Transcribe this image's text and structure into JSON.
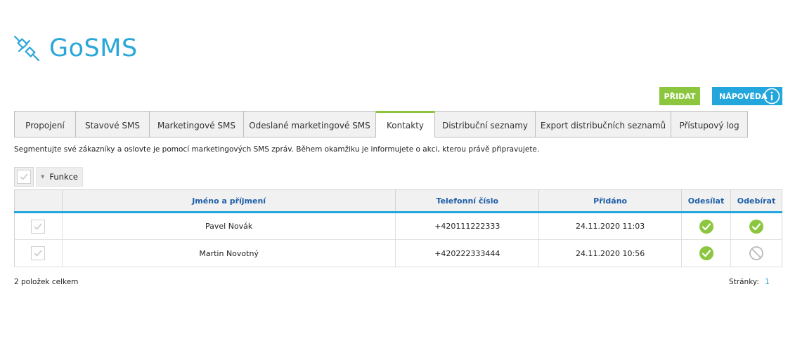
{
  "brand": {
    "name": "GoSMS",
    "color": "#2aa7d8",
    "logo_icon": "plug-connector-icon"
  },
  "header": {
    "add_label": "PŘIDAT",
    "help_label": "NÁPOVĚDA",
    "add_color": "#8cc63f",
    "help_color": "#23a6dc"
  },
  "tabs": [
    {
      "label": "Propojení",
      "active": false
    },
    {
      "label": "Stavové SMS",
      "active": false
    },
    {
      "label": "Marketingové SMS",
      "active": false
    },
    {
      "label": "Odeslané marketingové SMS",
      "active": false
    },
    {
      "label": "Kontakty",
      "active": true
    },
    {
      "label": "Distribuční seznamy",
      "active": false
    },
    {
      "label": "Export distribučních seznamů",
      "active": false
    },
    {
      "label": "Přístupový log",
      "active": false
    }
  ],
  "description": "Segmentujte své zákazníky a oslovte je pomocí marketingových SMS zpráv. Během okamžiku je informujete o akci, kterou právě připravujete.",
  "toolbar": {
    "functions_label": "Funkce"
  },
  "table": {
    "columns": [
      "Jméno a příjmení",
      "Telefonní číslo",
      "Přidáno",
      "Odesílat",
      "Odebírat"
    ],
    "rows": [
      {
        "name": "Pavel Novák",
        "phone": "+420111222333",
        "added": "24.11.2020 11:03",
        "send": "check",
        "subscribe": "check"
      },
      {
        "name": "Martin Novotný",
        "phone": "+420222333444",
        "added": "24.11.2020 10:56",
        "send": "check",
        "subscribe": "forbidden"
      }
    ]
  },
  "footer": {
    "total": "2 položek celkem",
    "pages_label": "Stránky:",
    "page": "1"
  }
}
